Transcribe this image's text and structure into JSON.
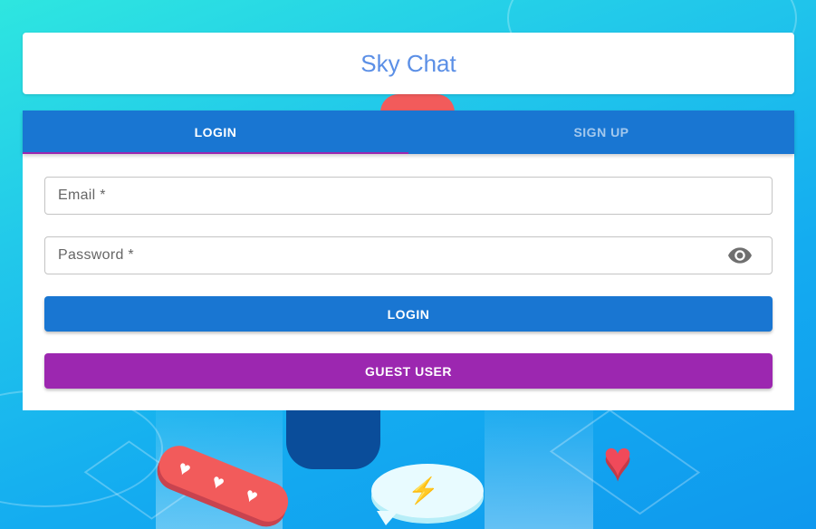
{
  "app": {
    "title": "Sky Chat"
  },
  "tabs": [
    {
      "label": "LOGIN",
      "active": true
    },
    {
      "label": "SIGN UP",
      "active": false
    }
  ],
  "form": {
    "email_label": "Email *",
    "password_label": "Password *",
    "password_toggle_icon": "eye-icon"
  },
  "buttons": {
    "login_label": "LOGIN",
    "guest_label": "GUEST USER"
  },
  "colors": {
    "primary": "#1976d2",
    "secondary": "#9c27b0",
    "title": "#5b8fe6"
  }
}
